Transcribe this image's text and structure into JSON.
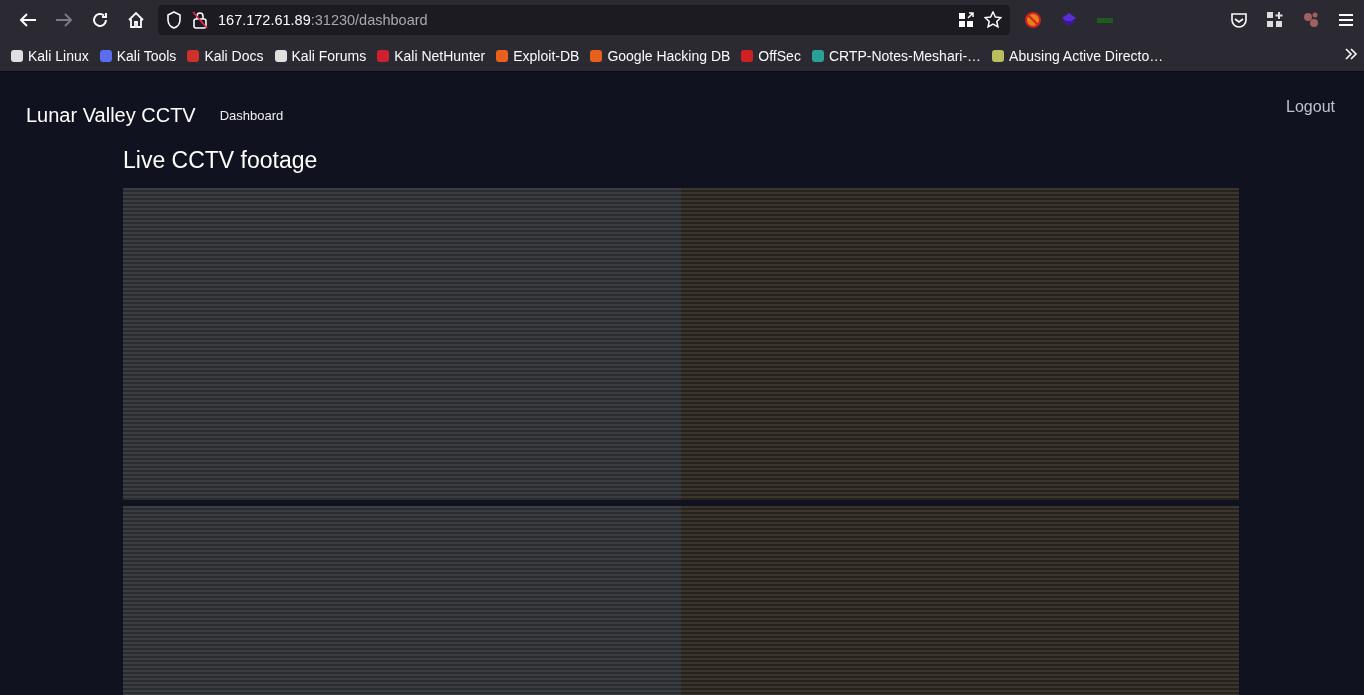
{
  "browser": {
    "back_enabled": true,
    "forward_enabled": false,
    "url": {
      "host": "167.172.61.89",
      "path": ":31230/dashboard"
    }
  },
  "bookmarks": [
    {
      "label": "Kali Linux",
      "color": "#e0e0e0"
    },
    {
      "label": "Kali Tools",
      "color": "#5a6cf0"
    },
    {
      "label": "Kali Docs",
      "color": "#d0302a"
    },
    {
      "label": "Kali Forums",
      "color": "#e0e0e0"
    },
    {
      "label": "Kali NetHunter",
      "color": "#d02030"
    },
    {
      "label": "Exploit-DB",
      "color": "#e8601c"
    },
    {
      "label": "Google Hacking DB",
      "color": "#e8601c"
    },
    {
      "label": "OffSec",
      "color": "#d02020"
    },
    {
      "label": "CRTP-Notes-Meshari-…",
      "color": "#2aa198"
    },
    {
      "label": "Abusing Active Directo…",
      "color": "#b8c060"
    }
  ],
  "nav": {
    "brand": "Lunar Valley CCTV",
    "links": [
      "Dashboard"
    ],
    "logout": "Logout"
  },
  "page": {
    "title": "Live CCTV footage",
    "camera_feeds": [
      {
        "kind": "video"
      },
      {
        "kind": "video"
      },
      {
        "kind": "video"
      },
      {
        "kind": "video"
      }
    ]
  }
}
